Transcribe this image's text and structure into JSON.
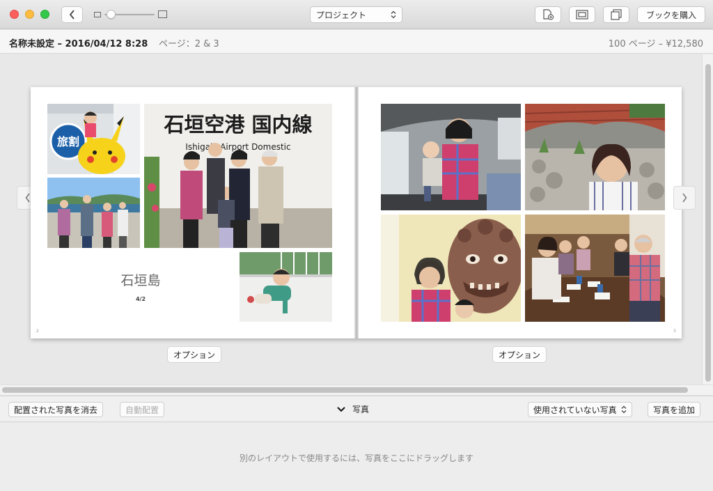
{
  "toolbar": {
    "project_label": "プロジェクト",
    "buy_label": "ブックを購入"
  },
  "info": {
    "doc_title": "名称未設定 – 2016/04/12 8:28",
    "pages": "ページ：2 & 3",
    "price": "100 ページ – ¥12,580"
  },
  "spread": {
    "caption": "石垣島",
    "subcaption": "4/2",
    "left_page_number": "2",
    "right_page_number": "3",
    "options_label": "オプション"
  },
  "photos": {
    "left_top_small": {
      "sign_text": "旅割"
    },
    "left_large": {
      "sign_text": "石垣空港 国内線",
      "sign_subtext": "Ishigaki Airport  Domestic"
    }
  },
  "tray": {
    "clear_label": "配置された写真を消去",
    "auto_label": "自動配置",
    "section_label": "写真",
    "filter_label": "使用されていない写真",
    "add_label": "写真を追加",
    "hint": "別のレイアウトで使用するには、写真をここにドラッグします"
  },
  "colors": {
    "close": "#fc605c",
    "minimize": "#fdbc40",
    "zoom": "#34c84a"
  }
}
